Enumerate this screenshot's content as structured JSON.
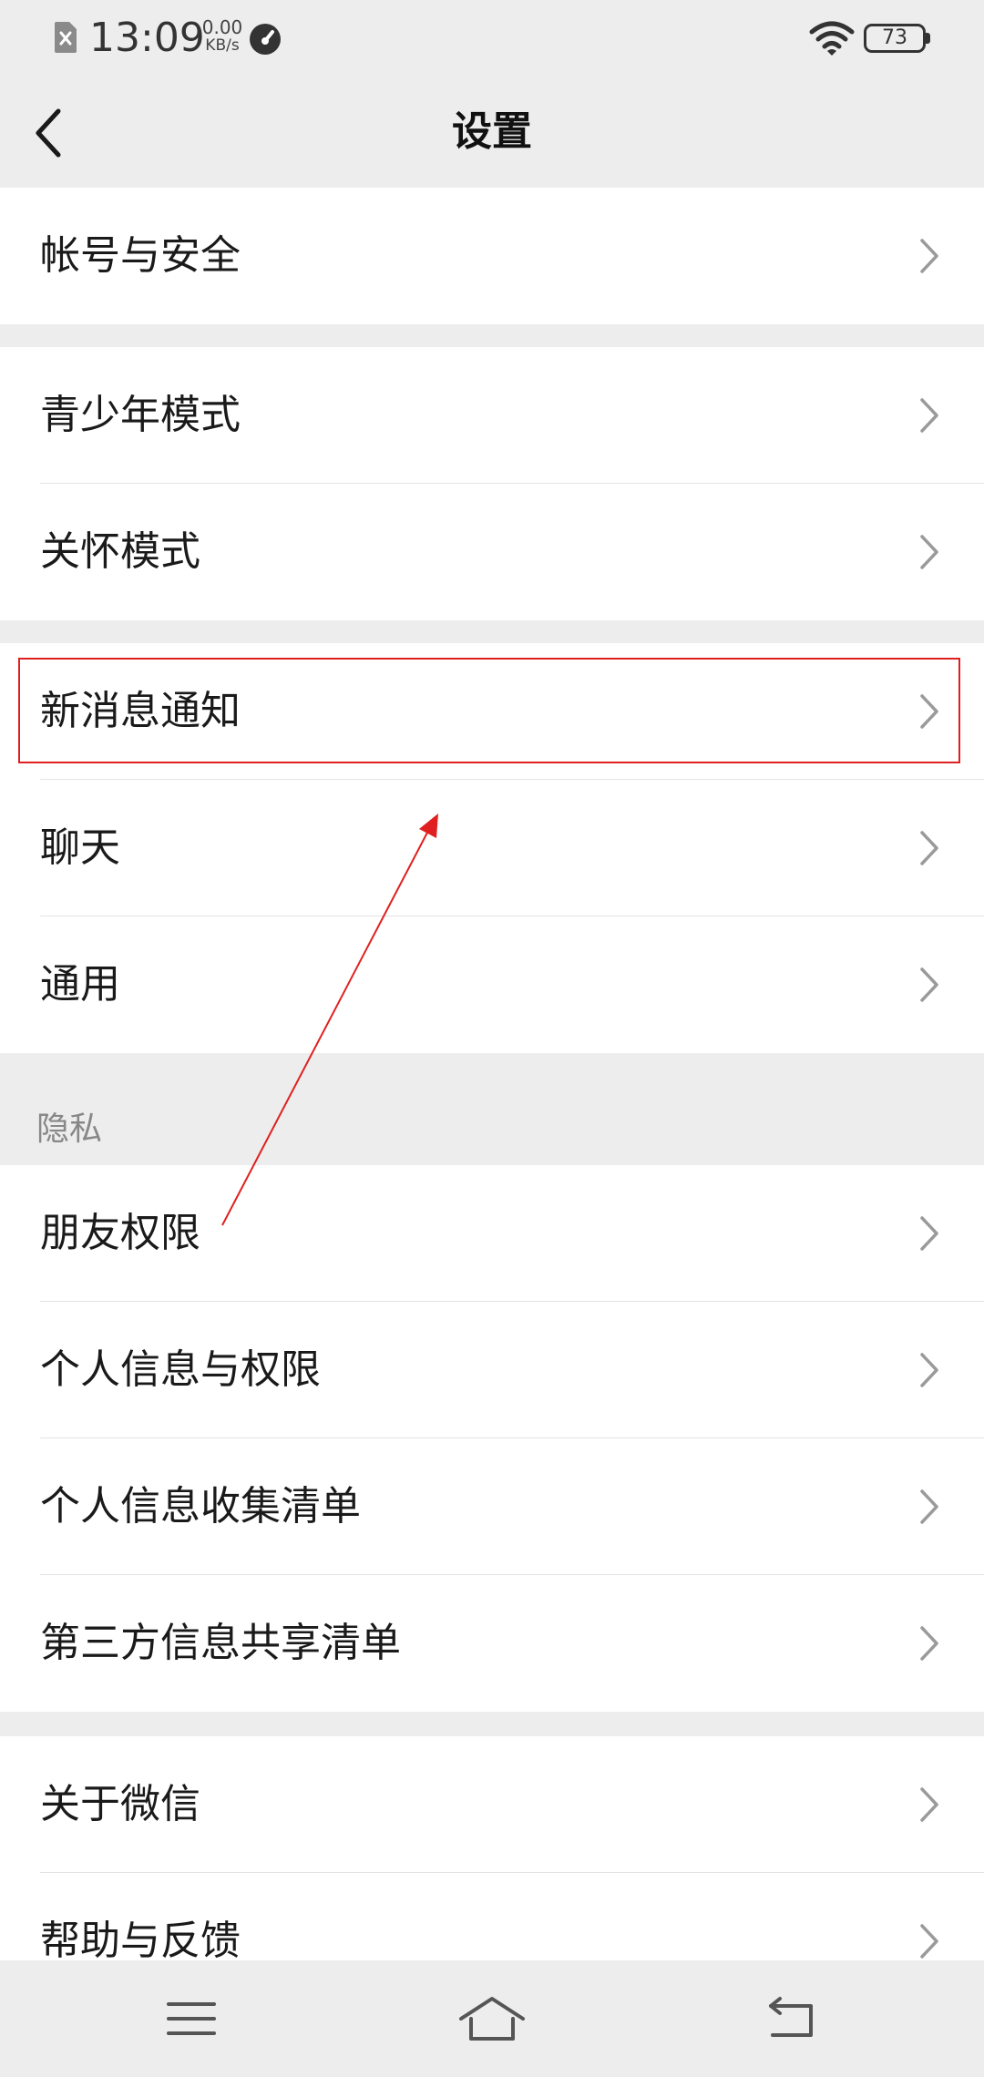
{
  "status_bar": {
    "time": "13:09",
    "net_speed_value": "0.00",
    "net_speed_unit": "KB/s",
    "battery_level": "73",
    "icons": [
      "sim-error-icon",
      "speed-meter-icon",
      "wifi-icon",
      "battery-icon"
    ]
  },
  "header": {
    "title": "设置",
    "back_icon": "chevron-left-icon"
  },
  "sections": {
    "account": {
      "items": [
        {
          "label": "帐号与安全"
        }
      ]
    },
    "modes": {
      "items": [
        {
          "label": "青少年模式"
        },
        {
          "label": "关怀模式"
        }
      ]
    },
    "general": {
      "items": [
        {
          "label": "新消息通知"
        },
        {
          "label": "聊天"
        },
        {
          "label": "通用"
        }
      ]
    },
    "privacy": {
      "header": "隐私",
      "items": [
        {
          "label": "朋友权限"
        },
        {
          "label": "个人信息与权限"
        },
        {
          "label": "个人信息收集清单"
        },
        {
          "label": "第三方信息共享清单"
        }
      ]
    },
    "about": {
      "items": [
        {
          "label": "关于微信"
        },
        {
          "label": "帮助与反馈"
        }
      ]
    }
  },
  "annotation": {
    "color": "#e02020"
  },
  "system_nav": {
    "icons": [
      "menu-icon",
      "home-icon",
      "back-icon"
    ]
  }
}
